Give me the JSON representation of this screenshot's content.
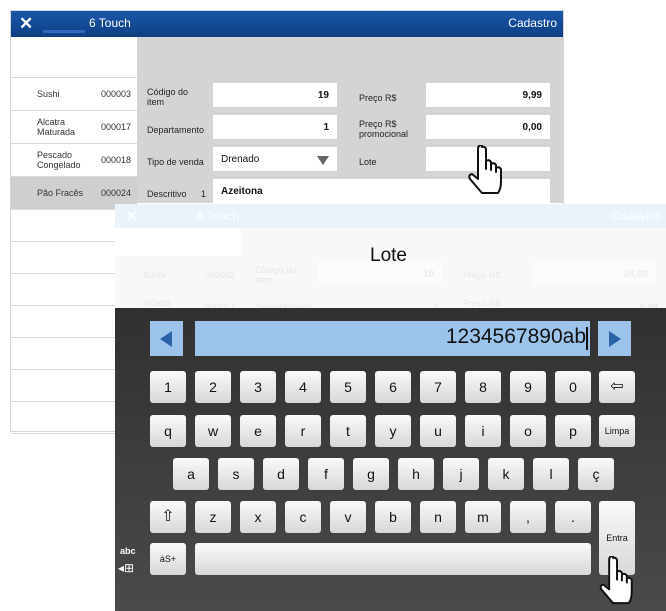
{
  "back": {
    "title": {
      "close": "✕",
      "app": "6 Touch",
      "section": "Cadastro"
    },
    "products": [
      {
        "name": "Sushi",
        "code": "000003"
      },
      {
        "name": "Alcatra Maturada",
        "code": "000017"
      },
      {
        "name": "Pescado Congelado",
        "code": "000018"
      },
      {
        "name": "Pão Fracês",
        "code": "000024"
      }
    ],
    "form": {
      "codigo_label": "Código do item",
      "codigo": "19",
      "preco_label": "Preço R$",
      "preco": "9,99",
      "departamento_label": "Departamento",
      "departamento": "1",
      "promo_label": "Preço R$ promocional",
      "promo": "0,00",
      "tipo_label": "Tipo de venda",
      "tipo": "Drenado",
      "lote_label": "Lote",
      "lote": "",
      "descritivo_label": "Descritivo",
      "descritivo_num": "1",
      "descritivo": "Azeitona"
    }
  },
  "front": {
    "title": {
      "close": "✕",
      "app": "6 Touch",
      "section": "Cadastro"
    },
    "ghost": {
      "row1_name": "Sushi",
      "row1_code": "000003",
      "row1_label": "Código do item",
      "row1_value": "18",
      "row1_price_label": "Preço R$",
      "row1_price": "24,90",
      "row2_name": "Alcatra",
      "row2_code": "000017",
      "row2_label": "Departamento",
      "row2_value": "1",
      "row2_price_label": "Preço R$",
      "row2_price": "0,00"
    },
    "dialog_title": "Lote",
    "input_value": "1234567890ab",
    "keys": {
      "row1": [
        "1",
        "2",
        "3",
        "4",
        "5",
        "6",
        "7",
        "8",
        "9",
        "0"
      ],
      "row2": [
        "q",
        "w",
        "e",
        "r",
        "t",
        "y",
        "u",
        "i",
        "o",
        "p"
      ],
      "row3": [
        "a",
        "s",
        "d",
        "f",
        "g",
        "h",
        "j",
        "k",
        "l",
        "ç"
      ],
      "row4": [
        "z",
        "x",
        "c",
        "v",
        "b",
        "n",
        "m",
        ",",
        "."
      ],
      "backspace": "⇦",
      "limpa": "Limpa",
      "shift": "⇧",
      "symbols": "áS+",
      "entra": "Entra",
      "abc": "abc",
      "lang_icon": "◂⊞"
    }
  }
}
